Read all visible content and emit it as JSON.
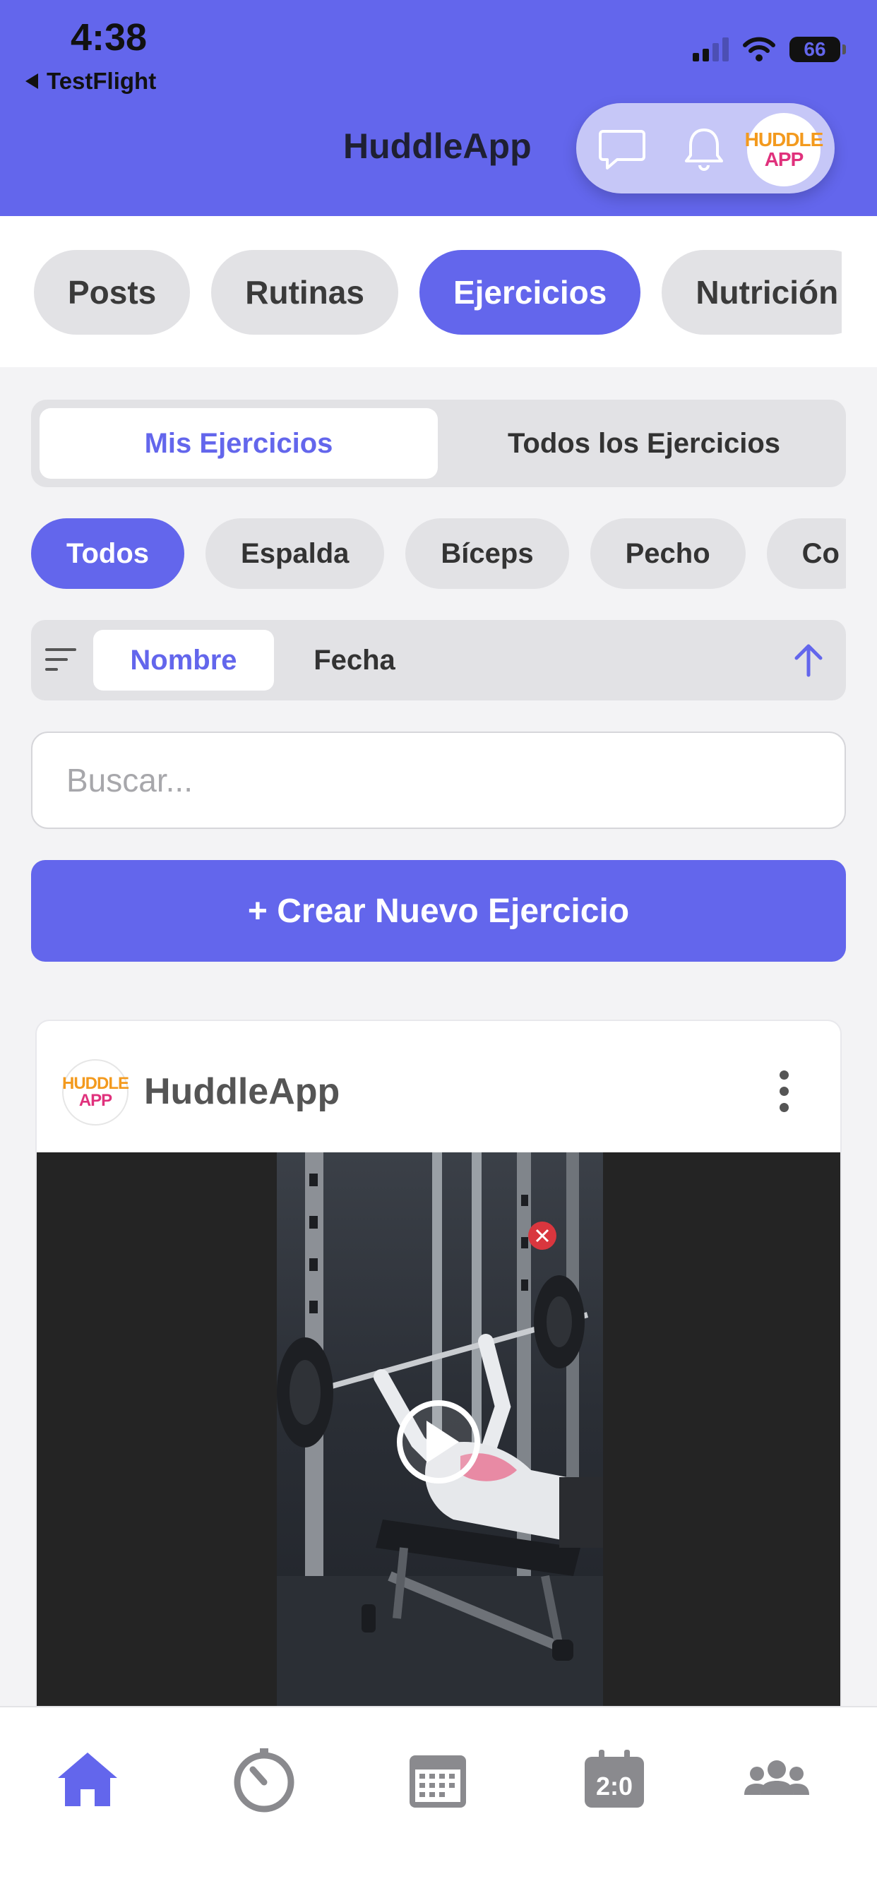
{
  "status_bar": {
    "time": "4:38",
    "back_app": "TestFlight",
    "battery": "66"
  },
  "header": {
    "title": "HuddleApp",
    "logo_line1": "HUDDLE",
    "logo_line2": "APP",
    "accent_color": "#6366ec"
  },
  "category_tabs": [
    "Posts",
    "Rutinas",
    "Ejercicios",
    "Nutrición"
  ],
  "category_active": "Ejercicios",
  "segment": {
    "mine": "Mis Ejercicios",
    "all": "Todos los Ejercicios",
    "active": "Mis Ejercicios"
  },
  "filters": [
    "Todos",
    "Espalda",
    "Bíceps",
    "Pecho",
    "Co"
  ],
  "filter_active": "Todos",
  "sort": {
    "by_name": "Nombre",
    "by_date": "Fecha",
    "active": "Nombre",
    "direction": "ascending"
  },
  "search": {
    "placeholder": "Buscar..."
  },
  "create_button": "+ Crear Nuevo Ejercicio",
  "post": {
    "author": "HuddleApp",
    "logo_line1": "HUDDLE",
    "logo_line2": "APP"
  },
  "bottom_nav": [
    "home-icon",
    "timer-icon",
    "calendar-icon",
    "scoreboard-icon",
    "community-icon"
  ],
  "bottom_nav_active": "home-icon"
}
